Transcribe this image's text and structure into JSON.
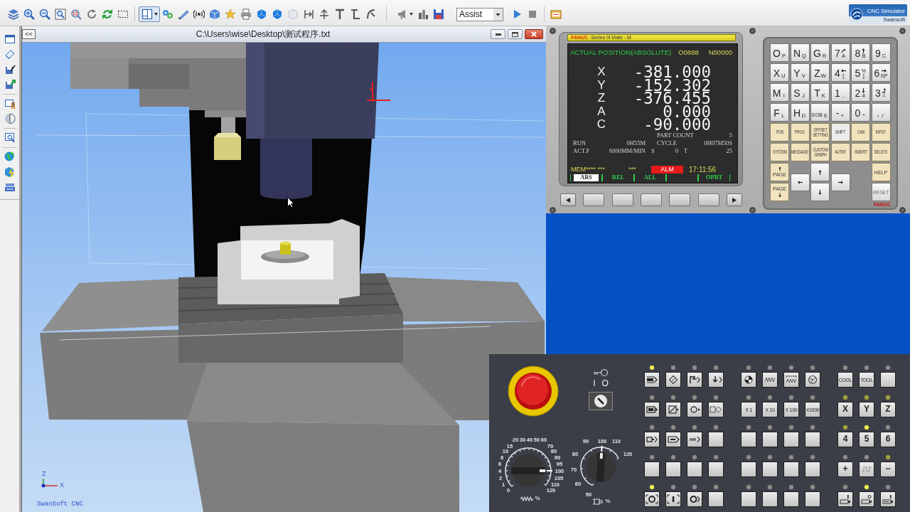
{
  "toolbar": {
    "buttons": [
      {
        "selected": false
      },
      {
        "selected": false
      },
      {
        "selected": false
      },
      {
        "selected": false
      },
      {
        "selected": false
      },
      {
        "selected": false
      },
      {
        "selected": false
      },
      {
        "selected": false
      },
      {
        "selected": true
      },
      {
        "selected": false
      },
      {
        "selected": false
      },
      {
        "selected": false
      },
      {
        "selected": false
      },
      {
        "selected": false
      },
      {
        "selected": false
      },
      {
        "selected": false
      },
      {
        "selected": false
      },
      {
        "selected": false
      },
      {
        "selected": false
      },
      {
        "selected": false
      },
      {
        "selected": false
      },
      {
        "selected": false
      },
      {
        "selected": false
      },
      {
        "selected": false
      },
      {
        "selected": false
      },
      {
        "selected": false
      },
      {
        "selected": false
      },
      {
        "selected": false
      },
      {
        "selected": false
      }
    ],
    "mode_dropdown": {
      "value": "Assist"
    },
    "logo": {
      "title": "CNC Simulator",
      "subtitle": "Swansoft"
    }
  },
  "viewport": {
    "collapse_button": "<<",
    "title": "C:\\Users\\wise\\Desktop\\测试程序.txt",
    "axis_labels": [
      "Z",
      "X"
    ],
    "brand_label": "SwanSoft CNC"
  },
  "cnc_screen": {
    "header": {
      "brand": "FANUC",
      "model": "Series 0i Mate - M"
    },
    "title": "ACTUAL POSITION(ABSOLUTE)",
    "program": "O0888",
    "sequence": "N00000",
    "axes": [
      {
        "name": "X",
        "value": "-381.000"
      },
      {
        "name": "Y",
        "value": "-152.302"
      },
      {
        "name": "Z",
        "value": "-376.455"
      },
      {
        "name": "A",
        "value": "0.000"
      },
      {
        "name": "C",
        "value": "-90.000"
      }
    ],
    "part_count": {
      "label": "PART COUNT",
      "value": "5"
    },
    "run_time": {
      "label": "RUN",
      "value": "0H55M"
    },
    "cycle_time": {
      "label": "CYCLE",
      "value": "0H07M50S"
    },
    "feed": {
      "label": "ACT.F",
      "value": "6000MM/MIN"
    },
    "spindle": {
      "label": "S",
      "value": "0"
    },
    "tool": {
      "label": "T",
      "value": "25"
    },
    "status": {
      "mode": "MEM**** ***",
      "flag": "***",
      "alarm": "ALM",
      "time": "17:11:56"
    },
    "softkeys": [
      {
        "label": "ABS",
        "selected": true
      },
      {
        "label": "REL",
        "selected": false
      },
      {
        "label": "ALL",
        "selected": false
      },
      {
        "selected": false
      },
      {
        "label": "OPRT",
        "selected": false
      }
    ]
  },
  "keypad": {
    "keys": [
      {
        "kind": "char",
        "main": "O",
        "sub": "P"
      },
      {
        "kind": "char",
        "main": "N",
        "sub": "Q"
      },
      {
        "kind": "char",
        "main": "G",
        "sub": "R"
      },
      {
        "kind": "char",
        "main": "7",
        "sub": "A"
      },
      {
        "kind": "char",
        "main": "8",
        "sub": "B"
      },
      {
        "kind": "char",
        "main": "9",
        "sub": "C"
      },
      {
        "kind": "char",
        "main": "X",
        "sub": "U"
      },
      {
        "kind": "char",
        "main": "Y",
        "sub": "V"
      },
      {
        "kind": "char",
        "main": "Z",
        "sub": "W"
      },
      {
        "kind": "char",
        "main": "4",
        "sub": "["
      },
      {
        "kind": "char",
        "main": "5",
        "sub": "]",
        "top": "%"
      },
      {
        "kind": "char",
        "main": "6",
        "sub": "SP"
      },
      {
        "kind": "char",
        "main": "M",
        "sub": "I"
      },
      {
        "kind": "char",
        "main": "S",
        "sub": "J"
      },
      {
        "kind": "char",
        "main": "T",
        "sub": "K"
      },
      {
        "kind": "char",
        "main": "1",
        "sub": ","
      },
      {
        "kind": "char",
        "main": "2",
        "sub": "#"
      },
      {
        "kind": "char",
        "main": "3",
        "sub": "="
      },
      {
        "kind": "char",
        "main": "F",
        "sub": "L"
      },
      {
        "kind": "char",
        "main": "H",
        "sub": "D"
      },
      {
        "kind": "word",
        "main": "EOB",
        "sub": "E"
      },
      {
        "kind": "char",
        "main": "-",
        "sub": "+"
      },
      {
        "kind": "char",
        "main": "0",
        "sub": "*"
      },
      {
        "kind": "char",
        "main": ".",
        "sub": "/"
      }
    ],
    "function_keys": [
      {
        "label": "POS",
        "color": "#f1e3bd"
      },
      {
        "label": "PROG",
        "color": "#f1e3bd"
      },
      {
        "label": "OFFSET SETTING",
        "color": "#f1e3bd"
      },
      {
        "label": "SHIFT",
        "color": "#ececec"
      },
      {
        "label": "CAN",
        "color": "#f1e3bd"
      },
      {
        "label": "INPUT",
        "color": "#f1e3bd"
      },
      {
        "label": "SYSTEM",
        "color": "#f1e3bd"
      },
      {
        "label": "MESSAGE",
        "color": "#f1e3bd"
      },
      {
        "label": "CUSTOM GRAPH",
        "color": "#f1e3bd"
      },
      {
        "label": "ALTER",
        "color": "#f1e3bd"
      },
      {
        "label": "INSERT",
        "color": "#f1e3bd"
      },
      {
        "label": "DELETE",
        "color": "#f1e3bd"
      }
    ],
    "page_up": "PAGE",
    "page_down": "PAGE",
    "help": "HELP",
    "reset": "RESET",
    "brand": "FANUC"
  },
  "machine_panel": {
    "key_switch": {
      "on_label": "I",
      "off_label": "O",
      "on": true
    },
    "feed_dial": {
      "unit": "%",
      "ticks": [
        {
          "label": "20",
          "selected": false
        },
        {
          "label": "30",
          "selected": false
        },
        {
          "label": "40",
          "selected": false
        },
        {
          "label": "50",
          "selected": false
        },
        {
          "label": "60",
          "selected": false
        },
        {
          "label": "15",
          "selected": false
        },
        {
          "label": "70",
          "selected": false
        },
        {
          "label": "10",
          "selected": false
        },
        {
          "label": "80",
          "selected": false
        },
        {
          "label": "8",
          "selected": false
        },
        {
          "label": "90",
          "selected": false
        },
        {
          "label": "6",
          "selected": false
        },
        {
          "label": "95",
          "selected": false
        },
        {
          "label": "4",
          "selected": false
        },
        {
          "label": "100",
          "selected": true
        },
        {
          "label": "2",
          "selected": false
        },
        {
          "label": "105",
          "selected": false
        },
        {
          "label": "1",
          "selected": false
        },
        {
          "label": "110",
          "selected": false
        },
        {
          "label": "0",
          "selected": false
        },
        {
          "label": "120",
          "selected": false
        }
      ]
    },
    "spindle_dial": {
      "unit": "%",
      "ticks": [
        {
          "label": "90",
          "selected": false
        },
        {
          "label": "100",
          "selected": true
        },
        {
          "label": "110",
          "selected": false
        },
        {
          "label": "80",
          "selected": false
        },
        {
          "label": "120",
          "selected": false
        },
        {
          "label": "70",
          "selected": false
        },
        {
          "label": "60",
          "selected": false
        },
        {
          "label": "50",
          "selected": false
        }
      ]
    },
    "button_groups": [
      {
        "rows": [
          [
            {
              "kind": "icon",
              "color": "#f5f24a"
            },
            {
              "kind": "icon",
              "color": "#8d8d8d"
            },
            {
              "kind": "icon",
              "color": "#8d8d8d"
            },
            {
              "kind": "icon",
              "color": "#8d8d8d"
            }
          ],
          [
            {
              "kind": "icon",
              "color": "#8d8d8d"
            },
            {
              "kind": "icon",
              "color": "#8d8d8d"
            },
            {
              "kind": "icon",
              "color": "#8d8d8d"
            },
            {
              "kind": "icon",
              "color": "#8d8d8d"
            }
          ],
          [
            {
              "kind": "icon",
              "color": "#8d8d8d"
            },
            {
              "kind": "icon",
              "color": "#8d8d8d"
            },
            {
              "kind": "icon",
              "color": "#8d8d8d"
            },
            {
              "kind": "blank",
              "color": "#8d8d8d"
            }
          ],
          [
            {
              "kind": "blank",
              "color": "#8d8d8d"
            },
            {
              "kind": "blank",
              "color": "#8d8d8d"
            },
            {
              "kind": "blank",
              "color": "#8d8d8d"
            },
            {
              "kind": "blank",
              "color": "#8d8d8d"
            }
          ],
          [
            {
              "kind": "icon",
              "color": "#f5f24a"
            },
            {
              "kind": "icon",
              "color": "#8d8d8d"
            },
            {
              "kind": "icon",
              "color": "#8d8d8d"
            },
            {
              "kind": "blank",
              "color": "#8d8d8d"
            }
          ]
        ]
      },
      {
        "rows": [
          [
            {
              "kind": "icon",
              "color": "#8d8d8d"
            },
            {
              "kind": "icon",
              "color": "#8d8d8d"
            },
            {
              "kind": "icon",
              "color": "#8d8d8d"
            },
            {
              "kind": "icon",
              "color": "#8d8d8d"
            }
          ],
          [
            {
              "kind": "caption",
              "label": "X 1",
              "color": "#8d8d8d"
            },
            {
              "kind": "caption",
              "label": "X 10",
              "color": "#8d8d8d"
            },
            {
              "kind": "caption",
              "label": "X 100",
              "color": "#8d8d8d"
            },
            {
              "kind": "caption",
              "label": "X1000",
              "color": "#8d8d8d"
            }
          ],
          [
            {
              "kind": "blank",
              "color": "#8d8d8d"
            },
            {
              "kind": "blank",
              "color": "#8d8d8d"
            },
            {
              "kind": "blank",
              "color": "#8d8d8d"
            },
            {
              "kind": "blank",
              "color": "#8d8d8d"
            }
          ],
          [
            {
              "kind": "blank",
              "color": "#8d8d8d"
            },
            {
              "kind": "blank",
              "color": "#8d8d8d"
            },
            {
              "kind": "blank",
              "color": "#8d8d8d"
            },
            {
              "kind": "blank",
              "color": "#8d8d8d"
            }
          ],
          [
            {
              "kind": "blank",
              "color": "#8d8d8d"
            },
            {
              "kind": "blank",
              "color": "#8d8d8d"
            },
            {
              "kind": "blank",
              "color": "#8d8d8d"
            },
            {
              "kind": "blank",
              "color": "#8d8d8d"
            }
          ]
        ]
      },
      {
        "rows": [
          [
            {
              "kind": "caption",
              "label": "COOL",
              "color": "#8d8d8d"
            },
            {
              "kind": "caption",
              "label": "TOOL",
              "color": "#8d8d8d"
            },
            {
              "kind": "blank",
              "color": "#8d8d8d"
            }
          ],
          [
            {
              "kind": "key",
              "label": "X",
              "color": "#a3a33a"
            },
            {
              "kind": "key",
              "label": "Y",
              "color": "#a3a33a"
            },
            {
              "kind": "key",
              "label": "Z",
              "color": "#a3a33a"
            }
          ],
          [
            {
              "kind": "key",
              "label": "4",
              "color": "#a3a33a"
            },
            {
              "kind": "key",
              "label": "5",
              "color": "#f5f24a"
            },
            {
              "kind": "key",
              "label": "6",
              "color": "#8d8d8d"
            }
          ],
          [
            {
              "kind": "key",
              "label": "+",
              "color": "#8d8d8d"
            },
            {
              "kind": "icon",
              "color": "#8d8d8d"
            },
            {
              "kind": "key",
              "label": "−",
              "color": "#a3a33a"
            }
          ],
          [
            {
              "kind": "icon",
              "color": "#8d8d8d"
            },
            {
              "kind": "icon",
              "color": "#f5f24a"
            },
            {
              "kind": "icon",
              "color": "#8d8d8d"
            }
          ]
        ]
      }
    ]
  }
}
